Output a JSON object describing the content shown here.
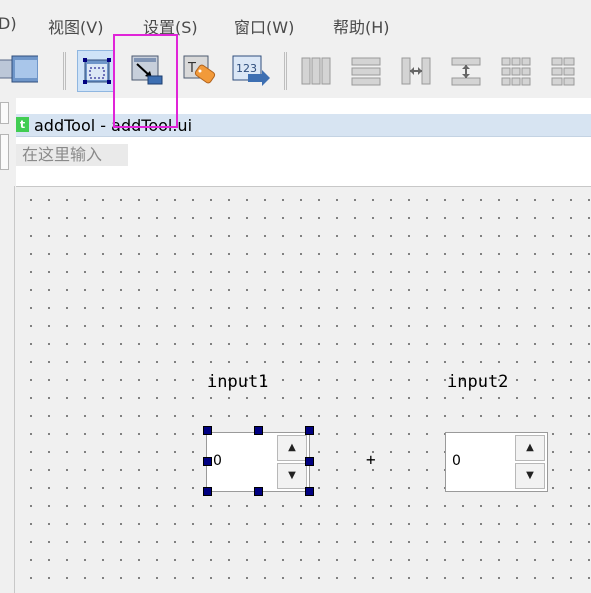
{
  "menubar": {
    "items": [
      "D)",
      "视图(V)",
      "设置(S)",
      "窗口(W)",
      "帮助(H)"
    ]
  },
  "toolbar": {
    "buttons": [
      {
        "icon": "window-cascade-icon"
      },
      {
        "icon": "edit-widgets-icon",
        "active": true
      },
      {
        "icon": "edit-signals-slots-icon"
      },
      {
        "icon": "edit-buddies-icon"
      },
      {
        "icon": "edit-tab-order-icon"
      },
      {
        "icon": "layout-horizontal-icon"
      },
      {
        "icon": "layout-vertical-icon"
      },
      {
        "icon": "layout-horizontal-splitter-icon"
      },
      {
        "icon": "layout-vertical-splitter-icon"
      },
      {
        "icon": "layout-grid-icon"
      },
      {
        "icon": "layout-form-icon"
      }
    ]
  },
  "form_window": {
    "icon_letter": "t",
    "title": "addTool - addTool.ui",
    "menu_placeholder": "在这里输入"
  },
  "form": {
    "input1_label": "input1",
    "input2_label": "input2",
    "plus_label": "+",
    "spinbox1_value": "0",
    "spinbox2_value": "0"
  },
  "colors": {
    "highlight": "#e024d8",
    "title_bar": "#d7e4f2",
    "selection_handle": "#000080"
  }
}
